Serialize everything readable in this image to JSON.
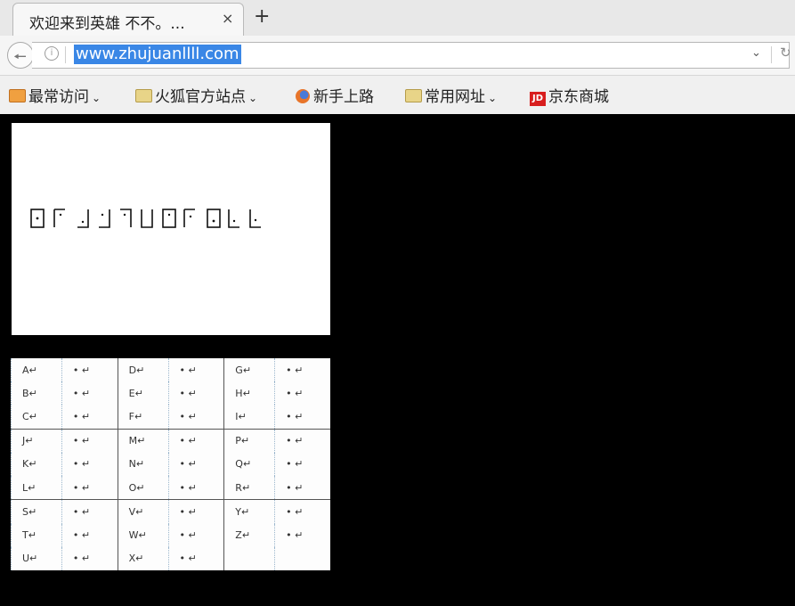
{
  "browser": {
    "tab_title": "欢迎来到英雄 不不。...",
    "tab_close": "×",
    "new_tab": "+",
    "url": "www.zhujuanllll.com"
  },
  "bookmarks": [
    {
      "label": "最常访问",
      "caret": true,
      "icon": "folder-orange-icon"
    },
    {
      "label": "火狐官方站点",
      "caret": true,
      "icon": "folder-icon"
    },
    {
      "label": "新手上路",
      "caret": false,
      "icon": "firefox-icon"
    },
    {
      "label": "常用网址",
      "caret": true,
      "icon": "folder-icon"
    },
    {
      "label": "京东商城",
      "caret": false,
      "icon": "jd-icon"
    }
  ],
  "cipher_key": {
    "rows": [
      [
        "A↵",
        "• ↵",
        "D↵",
        "• ↵",
        "G↵",
        "• ↵"
      ],
      [
        "B↵",
        "• ↵",
        "E↵",
        "• ↵",
        "H↵",
        "• ↵"
      ],
      [
        "C↵",
        "• ↵",
        "F↵",
        "• ↵",
        "I↵",
        "• ↵"
      ],
      [
        "J↵",
        "• ↵",
        "M↵",
        "• ↵",
        "P↵",
        "• ↵"
      ],
      [
        "K↵",
        "• ↵",
        "N↵",
        "• ↵",
        "Q↵",
        "• ↵"
      ],
      [
        "L↵",
        "• ↵",
        "O↵",
        "• ↵",
        "R↵",
        "• ↵"
      ],
      [
        "S↵",
        "• ↵",
        "V↵",
        "• ↵",
        "Y↵",
        "• ↵"
      ],
      [
        "T↵",
        "• ↵",
        "W↵",
        "• ↵",
        "Z↵",
        "• ↵"
      ],
      [
        "U↵",
        "• ↵",
        "X↵",
        "• ↵",
        "",
        ""
      ]
    ]
  }
}
